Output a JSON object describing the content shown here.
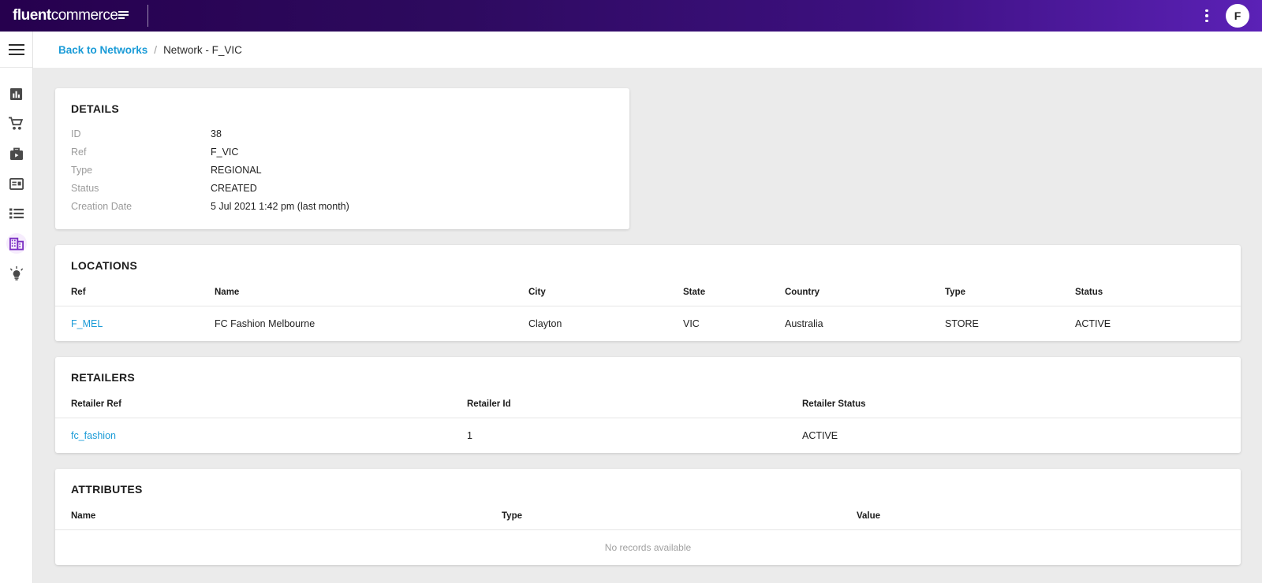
{
  "topbar": {
    "logo_bold": "fluent",
    "logo_regular": "commerce",
    "logo_mark_icon": "fluent-bars-mark",
    "kebab_icon": "more-vertical-icon",
    "avatar_initial": "F",
    "brand_purple_dark": "#26004e",
    "brand_purple_light": "#5b21b6"
  },
  "sidebar": {
    "menu_icon": "hamburger-menu-icon",
    "items": [
      {
        "icon": "reports-chart-icon",
        "name": "reports",
        "active": false
      },
      {
        "icon": "shopping-cart-icon",
        "name": "orders",
        "active": false
      },
      {
        "icon": "briefcase-media-icon",
        "name": "fulfilments",
        "active": false
      },
      {
        "icon": "card-layout-icon",
        "name": "inventory",
        "active": false
      },
      {
        "icon": "list-icon",
        "name": "catalogue",
        "active": false
      },
      {
        "icon": "building-network-icon",
        "name": "networks",
        "active": true
      },
      {
        "icon": "lightbulb-icon",
        "name": "settings",
        "active": false
      }
    ],
    "active_color": "#7a2ec2",
    "active_bg": "#f6ecfd",
    "idle_color": "#4a4a4a"
  },
  "breadcrumb": {
    "link_label": "Back to Networks",
    "separator": "/",
    "current": "Network - F_VIC",
    "link_color": "#1a9bd7"
  },
  "details": {
    "title": "DETAILS",
    "rows": [
      {
        "label": "ID",
        "value": "38"
      },
      {
        "label": "Ref",
        "value": "F_VIC"
      },
      {
        "label": "Type",
        "value": "REGIONAL"
      },
      {
        "label": "Status",
        "value": "CREATED"
      },
      {
        "label": "Creation Date",
        "value": "5 Jul 2021 1:42 pm (last month)"
      }
    ]
  },
  "locations": {
    "title": "LOCATIONS",
    "columns": [
      "Ref",
      "Name",
      "City",
      "State",
      "Country",
      "Type",
      "Status"
    ],
    "rows": [
      {
        "ref": "F_MEL",
        "name": "FC Fashion Melbourne",
        "city": "Clayton",
        "state": "VIC",
        "country": "Australia",
        "type": "STORE",
        "status": "ACTIVE"
      }
    ]
  },
  "retailers": {
    "title": "RETAILERS",
    "columns": [
      "Retailer Ref",
      "Retailer Id",
      "Retailer Status"
    ],
    "rows": [
      {
        "ref": "fc_fashion",
        "id": "1",
        "status": "ACTIVE"
      }
    ]
  },
  "attributes": {
    "title": "ATTRIBUTES",
    "columns": [
      "Name",
      "Type",
      "Value"
    ],
    "empty_message": "No records available"
  }
}
